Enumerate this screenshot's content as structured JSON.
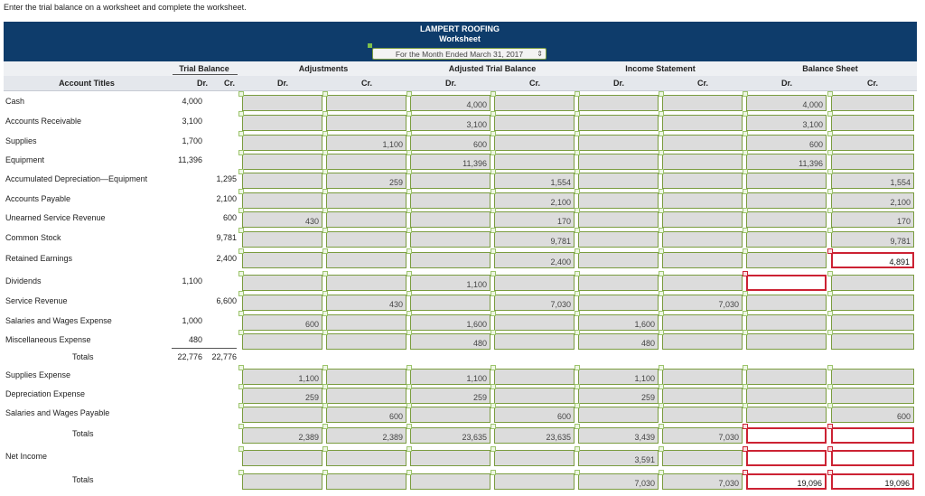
{
  "instruction": "Enter the trial balance on a worksheet and complete the worksheet.",
  "company": "LAMPERT ROOFING",
  "worksheet_title": "Worksheet",
  "period_select": {
    "selected": "For the Month Ended March 31, 2017"
  },
  "headers": {
    "account_titles": "Account Titles",
    "groups": [
      "Trial Balance",
      "Adjustments",
      "Adjusted Trial Balance",
      "Income Statement",
      "Balance Sheet"
    ],
    "dr": "Dr.",
    "cr": "Cr."
  },
  "colors": {
    "header_band": "#0e3c6b",
    "input_border": "#7a9c3f",
    "error_border": "#cc2233"
  },
  "rows": [
    {
      "account": "Cash",
      "tb_dr": "4,000",
      "tb_cr": "",
      "cells": [
        "",
        "",
        "4,000",
        "",
        "",
        "",
        "4,000",
        ""
      ]
    },
    {
      "account": "Accounts Receivable",
      "tb_dr": "3,100",
      "tb_cr": "",
      "cells": [
        "",
        "",
        "3,100",
        "",
        "",
        "",
        "3,100",
        ""
      ]
    },
    {
      "account": "Supplies",
      "tb_dr": "1,700",
      "tb_cr": "",
      "cells": [
        "",
        "1,100",
        "600",
        "",
        "",
        "",
        "600",
        ""
      ]
    },
    {
      "account": "Equipment",
      "tb_dr": "11,396",
      "tb_cr": "",
      "cells": [
        "",
        "",
        "11,396",
        "",
        "",
        "",
        "11,396",
        ""
      ]
    },
    {
      "account": "Accumulated Depreciation—Equipment",
      "tb_dr": "",
      "tb_cr": "1,295",
      "cells": [
        "",
        "259",
        "",
        "1,554",
        "",
        "",
        "",
        "1,554"
      ]
    },
    {
      "account": "Accounts Payable",
      "tb_dr": "",
      "tb_cr": "2,100",
      "cells": [
        "",
        "",
        "",
        "2,100",
        "",
        "",
        "",
        "2,100"
      ]
    },
    {
      "account": "Unearned Service Revenue",
      "tb_dr": "",
      "tb_cr": "600",
      "cells": [
        "430",
        "",
        "",
        "170",
        "",
        "",
        "",
        "170"
      ]
    },
    {
      "account": "Common Stock",
      "tb_dr": "",
      "tb_cr": "9,781",
      "cells": [
        "",
        "",
        "",
        "9,781",
        "",
        "",
        "",
        "9,781"
      ]
    },
    {
      "account": "Retained Earnings",
      "tb_dr": "",
      "tb_cr": "2,400",
      "cells": [
        "",
        "",
        "",
        "2,400",
        "",
        "",
        "",
        "4,891"
      ]
    },
    {
      "account": "Dividends",
      "tb_dr": "1,100",
      "tb_cr": "",
      "cells": [
        "",
        "",
        "1,100",
        "",
        "",
        "",
        "",
        ""
      ]
    },
    {
      "account": "Service Revenue",
      "tb_dr": "",
      "tb_cr": "6,600",
      "cells": [
        "",
        "430",
        "",
        "7,030",
        "",
        "7,030",
        "",
        ""
      ]
    },
    {
      "account": "Salaries and Wages Expense",
      "tb_dr": "1,000",
      "tb_cr": "",
      "cells": [
        "600",
        "",
        "1,600",
        "",
        "1,600",
        "",
        "",
        ""
      ]
    },
    {
      "account": "Miscellaneous Expense",
      "tb_dr": "480",
      "tb_cr": "",
      "cells": [
        "",
        "",
        "480",
        "",
        "480",
        "",
        "",
        ""
      ]
    },
    {
      "account": "Totals",
      "tb_dr": "22,776",
      "tb_cr": "22,776",
      "cells": []
    },
    {
      "account": "Supplies Expense",
      "tb_dr": "",
      "tb_cr": "",
      "cells": [
        "1,100",
        "",
        "1,100",
        "",
        "1,100",
        "",
        "",
        ""
      ]
    },
    {
      "account": "Depreciation Expense",
      "tb_dr": "",
      "tb_cr": "",
      "cells": [
        "259",
        "",
        "259",
        "",
        "259",
        "",
        "",
        ""
      ]
    },
    {
      "account": "Salaries and Wages Payable",
      "tb_dr": "",
      "tb_cr": "",
      "cells": [
        "",
        "600",
        "",
        "600",
        "",
        "",
        "",
        "600"
      ]
    },
    {
      "account": "Totals",
      "tb_dr": "",
      "tb_cr": "",
      "cells": [
        "2,389",
        "2,389",
        "23,635",
        "23,635",
        "3,439",
        "7,030",
        "",
        ""
      ]
    },
    {
      "account": "Net Income",
      "tb_dr": "",
      "tb_cr": "",
      "cells": [
        "",
        "",
        "",
        "",
        "3,591",
        "",
        "",
        ""
      ]
    },
    {
      "account": "Totals",
      "tb_dr": "",
      "tb_cr": "",
      "cells": [
        "",
        "",
        "",
        "",
        "7,030",
        "7,030",
        "19,096",
        "19,096"
      ]
    }
  ]
}
